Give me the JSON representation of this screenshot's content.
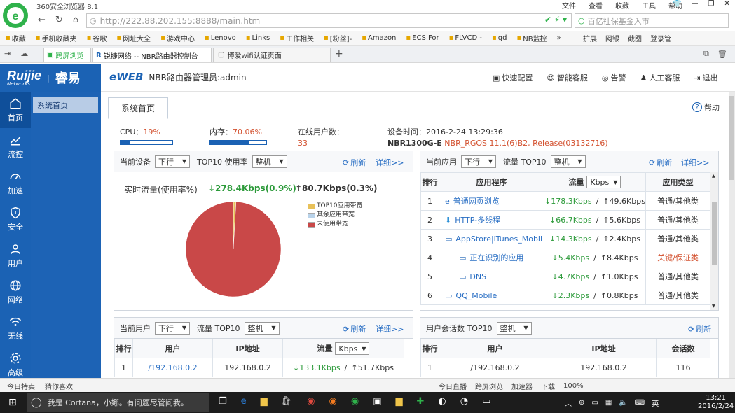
{
  "browser": {
    "title": "360安全浏览器 8.1",
    "menus": [
      "文件",
      "查看",
      "收藏",
      "工具",
      "帮助"
    ],
    "url": "http://222.88.202.155:8888/main.htm",
    "search_placeholder": "百亿社保基金入市",
    "bookmarks": [
      "收藏",
      "手机收藏夹",
      "谷歌",
      "网址大全",
      "游戏中心",
      "Lenovo",
      "Links",
      "工作相关",
      "[粉丝]-",
      "Amazon",
      "ECS For",
      "FLVCD -",
      "gd",
      "NB监控"
    ],
    "bm_right": [
      "扩展",
      "网银",
      "截图",
      "登录管"
    ],
    "tabs": [
      "跨屏浏览",
      "锐捷网络 -- NBR路由器控制台",
      "博爱wifi认证页面"
    ],
    "status_left": [
      "今日特卖",
      "猜你喜欢"
    ],
    "status_right": [
      "今日直播",
      "跨屏浏览",
      "加速器",
      "下载",
      "100%"
    ]
  },
  "taskbar": {
    "cortana": "我是 Cortana，小娜。有问题尽管问我。",
    "lang": "英",
    "time": "13:21",
    "date": "2016/2/24"
  },
  "app": {
    "logo": "Ruijie",
    "logo_sub": "Networks",
    "logo_cn": "睿易",
    "eweb": "eWEB",
    "admin": "NBR路由器管理员:admin",
    "header_actions": [
      "快速配置",
      "智能客服",
      "告警",
      "人工客服",
      "退出"
    ],
    "nav": [
      {
        "label": "首页",
        "icon": "home-icon"
      },
      {
        "label": "流控",
        "icon": "chart-icon"
      },
      {
        "label": "加速",
        "icon": "speed-icon"
      },
      {
        "label": "安全",
        "icon": "shield-icon"
      },
      {
        "label": "用户",
        "icon": "user-icon"
      },
      {
        "label": "网络",
        "icon": "globe-icon"
      },
      {
        "label": "无线",
        "icon": "wifi-icon"
      },
      {
        "label": "高级",
        "icon": "gear-icon"
      }
    ],
    "subnav": [
      "系统首页"
    ],
    "page_tab": "系统首页",
    "help": "帮助",
    "cpu_label": "CPU：",
    "cpu_value": "19%",
    "cpu_pct": 0.19,
    "mem_label": "内存：",
    "mem_value": "70.06%",
    "mem_pct": 0.7006,
    "online_label": "在线用户数：",
    "online_value": "33",
    "devtime_label": "设备时间：",
    "devtime": "2016-2-24 13:29:36",
    "model": "NBR1300G-E",
    "version": "NBR_RGOS 11.1(6)B2, Release(03132716)"
  },
  "p1": {
    "label_device": "当前设备",
    "sel1": "下行",
    "top10": "TOP10 使用率",
    "sel2": "整机",
    "refresh": "刷新",
    "detail": "详细>>",
    "realtime_label": "实时流量(使用率%)",
    "down": "↓278.4Kbps(0.9%)",
    "up": "↑80.7Kbps(0.3%)",
    "legend": [
      {
        "name": "TOP10应用带宽",
        "color": "#e8c15a"
      },
      {
        "name": "其余应用带宽",
        "color": "#b9d3ea"
      },
      {
        "name": "未使用带宽",
        "color": "#c94848"
      }
    ]
  },
  "chart_data": {
    "type": "pie",
    "slices": [
      {
        "name": "TOP10应用带宽",
        "value": 0.9
      },
      {
        "name": "其余应用带宽",
        "value": 0.0
      },
      {
        "name": "未使用带宽",
        "value": 99.1
      }
    ]
  },
  "p2": {
    "label": "当前应用",
    "sel1": "下行",
    "top10": "流量 TOP10",
    "sel2": "整机",
    "refresh": "刷新",
    "detail": "详细>>",
    "headers": [
      "排行",
      "应用程序",
      "流量",
      "应用类型"
    ],
    "unit": "Kbps",
    "rows": [
      {
        "rank": "1",
        "icon": "ie-icon",
        "name": "普通网页浏览",
        "down": "↓178.3Kbps",
        "up": "↑49.6Kbps",
        "type": "普通/其他类",
        "critical": false
      },
      {
        "rank": "2",
        "icon": "download-icon",
        "name": "HTTP-多线程",
        "down": "↓66.7Kbps",
        "up": "↑5.6Kbps",
        "type": "普通/其他类",
        "critical": false
      },
      {
        "rank": "3",
        "icon": "window-icon",
        "name": "AppStore|iTunes_Mobil",
        "down": "↓14.3Kbps",
        "up": "↑2.4Kbps",
        "type": "普通/其他类",
        "critical": false
      },
      {
        "rank": "4",
        "icon": "window-icon",
        "name": "正在识别的应用",
        "down": "↓5.4Kbps",
        "up": "↑8.4Kbps",
        "type": "关键/保证类",
        "critical": true
      },
      {
        "rank": "5",
        "icon": "window-icon",
        "name": "DNS",
        "down": "↓4.7Kbps",
        "up": "↑1.0Kbps",
        "type": "普通/其他类",
        "critical": false
      },
      {
        "rank": "6",
        "icon": "window-icon",
        "name": "QQ_Mobile",
        "down": "↓2.3Kbps",
        "up": "↑0.8Kbps",
        "type": "普通/其他类",
        "critical": false
      }
    ]
  },
  "p3": {
    "label": "当前用户",
    "sel1": "下行",
    "top10": "流量 TOP10",
    "sel2": "整机",
    "refresh": "刷新",
    "detail": "详细>>",
    "headers": [
      "排行",
      "用户",
      "IP地址",
      "流量"
    ],
    "unit": "Kbps",
    "rows": [
      {
        "rank": "1",
        "user": "/192.168.0.2",
        "ip": "192.168.0.2",
        "down": "↓133.1Kbps",
        "up": "↑51.7Kbps"
      }
    ]
  },
  "p4": {
    "label": "用户会话数 TOP10",
    "sel": "整机",
    "refresh": "刷新",
    "headers": [
      "排行",
      "用户",
      "IP地址",
      "会话数"
    ],
    "rows": [
      {
        "rank": "1",
        "user": "/192.168.0.2",
        "ip": "192.168.0.2",
        "sessions": "116"
      }
    ]
  }
}
